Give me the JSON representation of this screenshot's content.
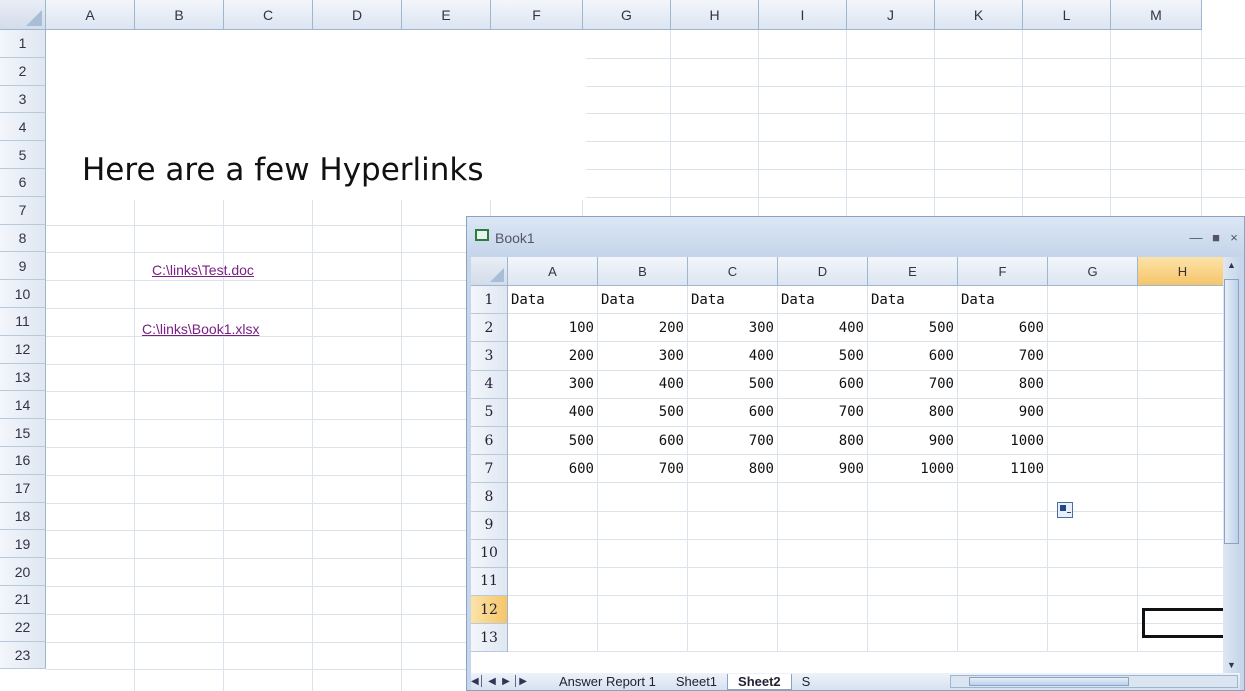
{
  "outer": {
    "columns": [
      "A",
      "B",
      "C",
      "D",
      "E",
      "F",
      "G",
      "H",
      "I",
      "J",
      "K",
      "L",
      "M"
    ],
    "rows": [
      "1",
      "2",
      "3",
      "4",
      "5",
      "6",
      "7",
      "8",
      "9",
      "10",
      "11",
      "12",
      "13",
      "14",
      "15",
      "16",
      "17",
      "18",
      "19",
      "20",
      "21",
      "22",
      "23"
    ],
    "headline": "Here are a few Hyperlinks",
    "links": [
      "C:\\links\\Test.doc",
      "C:\\links\\Book1.xlsx"
    ]
  },
  "window": {
    "title": "Book1",
    "minimize_icon": "minimize-icon",
    "maximize_icon": "maximize-icon",
    "close_icon": "close-icon",
    "columns": [
      "A",
      "B",
      "C",
      "D",
      "E",
      "F",
      "G",
      "H"
    ],
    "selected_column": "H",
    "rows": [
      "1",
      "2",
      "3",
      "4",
      "5",
      "6",
      "7",
      "8",
      "9",
      "10",
      "11",
      "12",
      "13"
    ],
    "selected_row": "12",
    "table": {
      "header": [
        "Data",
        "Data",
        "Data",
        "Data",
        "Data",
        "Data"
      ],
      "data": [
        [
          100,
          200,
          300,
          400,
          500,
          600
        ],
        [
          200,
          300,
          400,
          500,
          600,
          700
        ],
        [
          300,
          400,
          500,
          600,
          700,
          800
        ],
        [
          400,
          500,
          600,
          700,
          800,
          900
        ],
        [
          500,
          600,
          700,
          800,
          900,
          1000
        ],
        [
          600,
          700,
          800,
          900,
          1000,
          1100
        ]
      ]
    },
    "sheet_tabs": [
      "Answer Report 1",
      "Sheet1",
      "Sheet2",
      "S"
    ],
    "active_tab": "Sheet2"
  }
}
